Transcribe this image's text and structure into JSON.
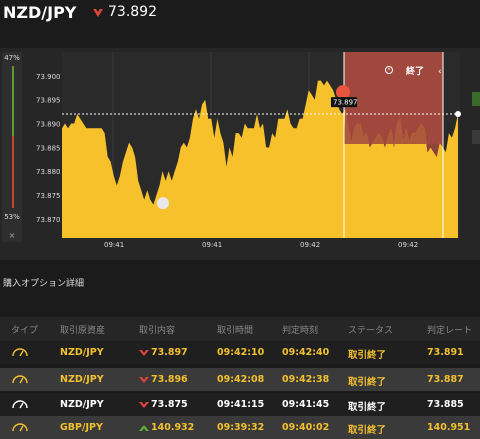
{
  "header": {
    "pair": "NZD/JPY",
    "rate": "73.892",
    "direction": "down",
    "down_color": "#e0473a",
    "up_color": "#5fb33a"
  },
  "gauge": {
    "top_label": "47%",
    "bottom_label": "53%",
    "close_label": "×",
    "up_share": 0.47,
    "down_share": 0.53
  },
  "chart": {
    "y_ticks": [
      "73.900",
      "73.895",
      "73.890",
      "73.885",
      "73.880",
      "73.875",
      "73.870"
    ],
    "x_ticks": [
      "09:41",
      "09:41",
      "09:42",
      "09:42"
    ],
    "end_label": "終了",
    "entry_label": "73.897",
    "area_color": "#f6c12a",
    "end_zone_color": "#a0483e"
  },
  "chart_data": {
    "type": "area",
    "ylim": [
      73.866,
      73.905
    ],
    "current_level": 73.892,
    "entries": [
      {
        "rate": 73.897,
        "direction": "down"
      },
      {
        "rate": 73.875,
        "direction": "down"
      }
    ],
    "values": [
      73.889,
      73.89,
      73.889,
      73.89,
      73.89,
      73.892,
      73.891,
      73.89,
      73.889,
      73.889,
      73.889,
      73.889,
      73.889,
      73.889,
      73.888,
      73.883,
      73.882,
      73.879,
      73.877,
      73.879,
      73.882,
      73.884,
      73.886,
      73.885,
      73.883,
      73.878,
      73.876,
      73.874,
      73.876,
      73.874,
      73.873,
      73.875,
      73.877,
      73.88,
      73.878,
      73.88,
      73.878,
      73.88,
      73.882,
      73.885,
      73.886,
      73.885,
      73.887,
      73.891,
      73.893,
      73.891,
      73.894,
      73.895,
      73.891,
      73.891,
      73.887,
      73.891,
      73.888,
      73.886,
      73.881,
      73.885,
      73.883,
      73.888,
      73.888,
      73.887,
      73.89,
      73.889,
      73.889,
      73.889,
      73.892,
      73.889,
      73.89,
      73.885,
      73.885,
      73.888,
      73.887,
      73.891,
      73.891,
      73.891,
      73.893,
      73.89,
      73.889,
      73.889,
      73.891,
      73.891,
      73.894,
      73.897,
      73.896,
      73.895,
      73.899,
      73.899,
      73.898,
      73.899,
      73.898,
      73.897,
      73.895,
      73.893,
      73.892,
      73.893,
      73.889,
      73.886,
      73.889,
      73.89,
      73.89,
      73.887,
      73.888,
      73.885,
      73.886,
      73.887,
      73.888,
      73.887,
      73.885,
      73.887,
      73.889,
      73.885,
      73.89,
      73.891,
      73.886,
      73.889,
      73.886,
      73.888,
      73.888,
      73.889,
      73.89,
      73.889,
      73.884,
      73.885,
      73.884,
      73.883,
      73.886,
      73.885,
      73.884,
      73.888,
      73.887,
      73.889,
      73.892
    ]
  },
  "options_section": {
    "title": "購入オプション詳細"
  },
  "table": {
    "columns": [
      "タイプ",
      "取引原資産",
      "取引内容",
      "取引時間",
      "判定時刻",
      "ステータス",
      "判定レート"
    ],
    "rows": [
      {
        "asset": "NZD/JPY",
        "direction": "down",
        "rate": "73.897",
        "trade_time": "09:42:10",
        "judge_time": "09:42:40",
        "status": "取引終了",
        "judge_rate": "73.891",
        "text_color": "#f2c12e"
      },
      {
        "asset": "NZD/JPY",
        "direction": "down",
        "rate": "73.896",
        "trade_time": "09:42:08",
        "judge_time": "09:42:38",
        "status": "取引終了",
        "judge_rate": "73.887",
        "text_color": "#f2c12e"
      },
      {
        "asset": "NZD/JPY",
        "direction": "down",
        "rate": "73.875",
        "trade_time": "09:41:15",
        "judge_time": "09:41:45",
        "status": "取引終了",
        "judge_rate": "73.885",
        "text_color": "#ffffff"
      },
      {
        "asset": "GBP/JPY",
        "direction": "up",
        "rate": "140.932",
        "trade_time": "09:39:32",
        "judge_time": "09:40:02",
        "status": "取引終了",
        "judge_rate": "140.951",
        "text_color": "#f2c12e"
      }
    ]
  }
}
